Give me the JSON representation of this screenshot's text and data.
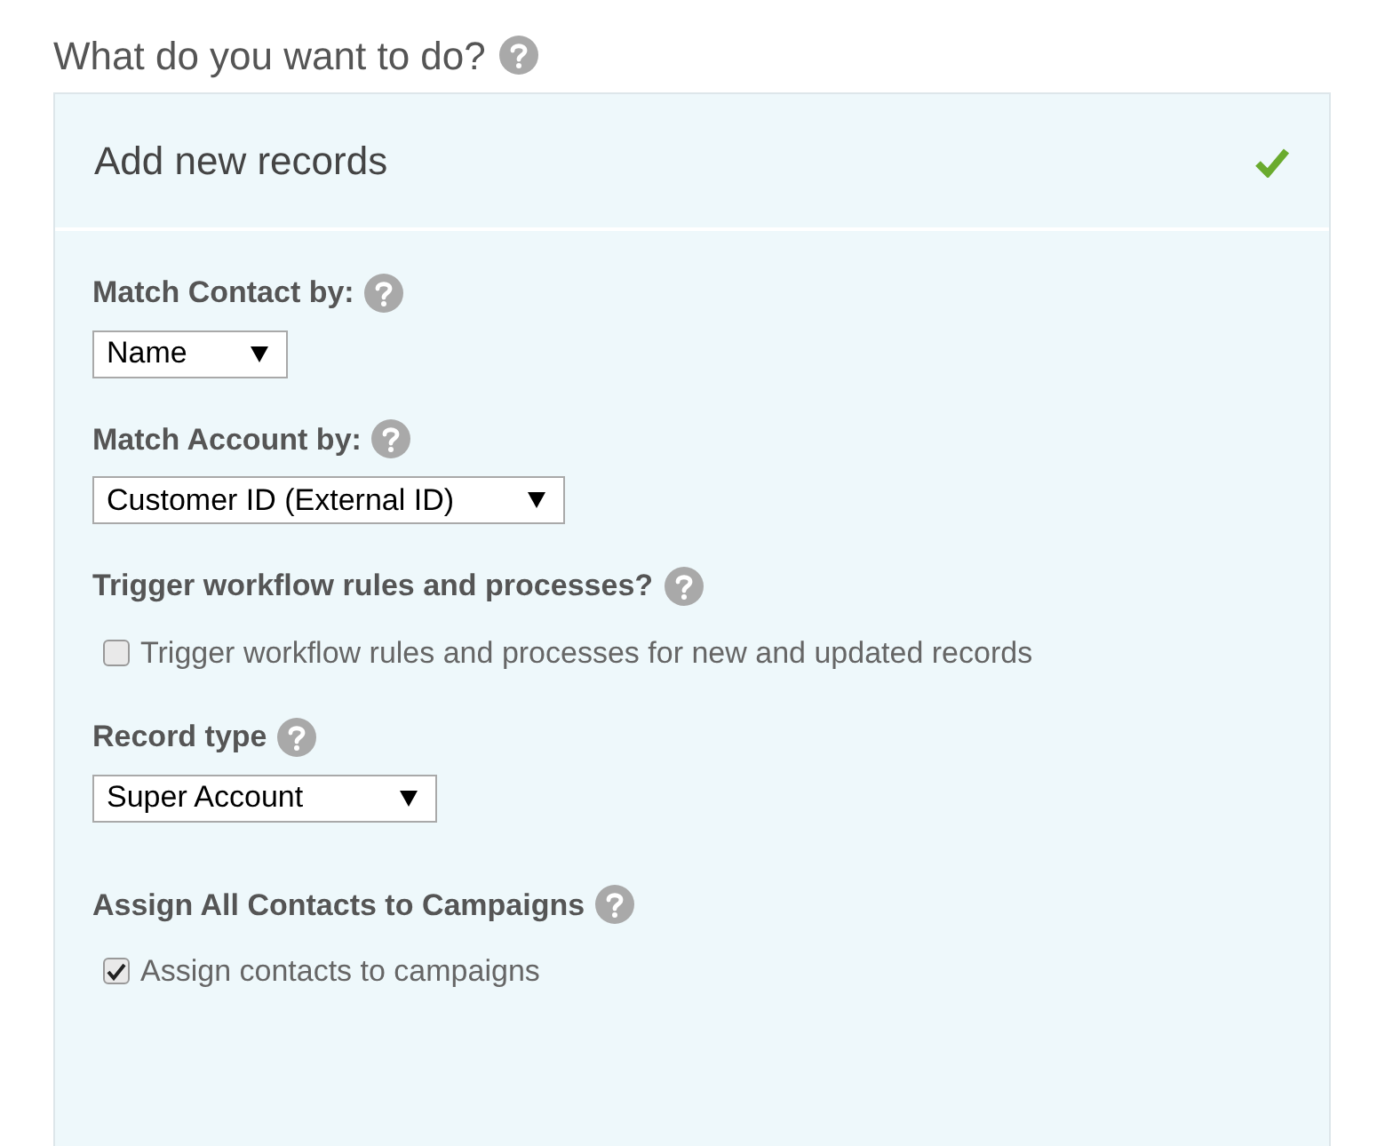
{
  "heading": "What do you want to do?",
  "panel": {
    "title": "Add new records",
    "selected": true
  },
  "fields": [
    {
      "kind": "select",
      "label": "Match Contact by:",
      "value": "Name"
    },
    {
      "kind": "select",
      "label": "Match Account by:",
      "value": "Customer ID (External ID)"
    },
    {
      "kind": "checkbox",
      "label": "Trigger workflow rules and processes?",
      "option": "Trigger workflow rules and processes for new and updated records",
      "checked": false
    },
    {
      "kind": "select",
      "label": "Record type",
      "value": "Super Account"
    },
    {
      "kind": "checkbox",
      "label": "Assign All Contacts to Campaigns",
      "option": "Assign contacts to campaigns",
      "checked": true
    }
  ]
}
